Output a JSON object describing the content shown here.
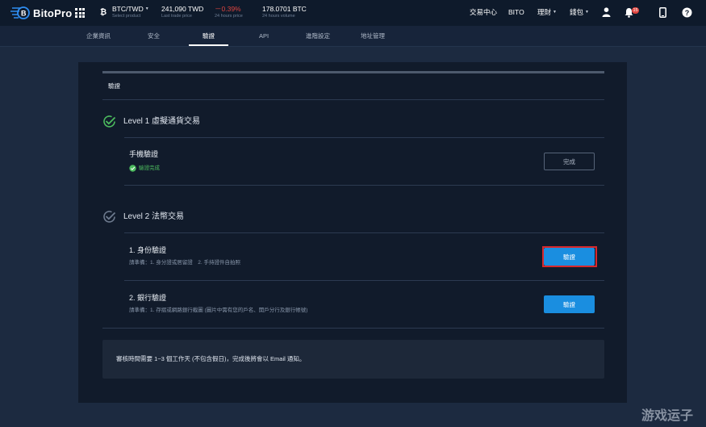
{
  "header": {
    "logo": "BitoPro",
    "pair": {
      "value": "BTC/TWD",
      "label": "Select product"
    },
    "last_price": {
      "value": "241,090 TWD",
      "label": "Last trade price"
    },
    "change": {
      "value": "－0.39%",
      "label": "24 hours price"
    },
    "volume": {
      "value": "178.0701 BTC",
      "label": "24 hours volume"
    },
    "nav": [
      "交易中心",
      "BITO",
      "理財",
      "錢包"
    ],
    "notification_count": "15",
    "colors": {
      "negative": "#e0453f",
      "accent": "#1a8ee0",
      "success": "#4cbb5e"
    }
  },
  "tabs": [
    "企業資訊",
    "安全",
    "驗證",
    "API",
    "進階設定",
    "地址管理"
  ],
  "active_tab": "驗證",
  "panel": {
    "title": "驗證",
    "level1": {
      "title": "Level 1 虛擬通貨交易",
      "items": [
        {
          "title": "手機驗證",
          "status": "驗證完成",
          "button": "完成"
        }
      ]
    },
    "level2": {
      "title": "Level 2 法幣交易",
      "items": [
        {
          "title": "1. 身份驗證",
          "desc": "請準備：1. 身分證或居留證　2. 手持證件自拍照",
          "button": "驗證"
        },
        {
          "title": "2. 銀行驗證",
          "desc": "請準備：1. 存摺或網路銀行截圖 (圖片中需有您的戶名、開戶分行及銀行帳號)",
          "button": "驗證"
        }
      ]
    },
    "notice": "審核時間需要 1~3 個工作天 (不包含假日)，完成後將會以 Email 通知。"
  },
  "watermark": "游戏运子"
}
